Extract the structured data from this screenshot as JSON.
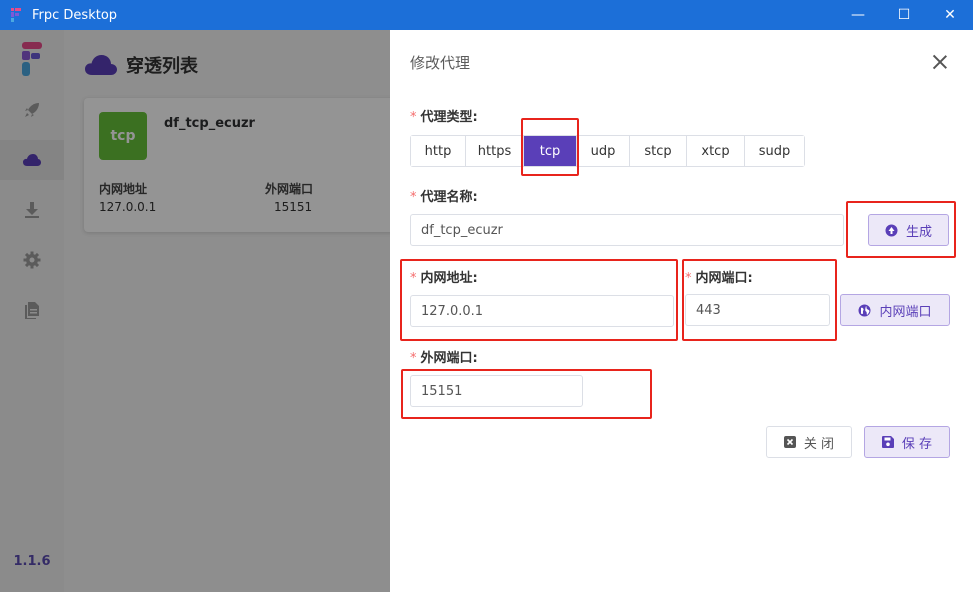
{
  "window": {
    "title": "Frpc Desktop",
    "controls": {
      "minimize": "—",
      "maximize": "☐",
      "close": "✕"
    }
  },
  "sidebar": {
    "version": "1.1.6",
    "items": [
      {
        "icon": "rocket-icon"
      },
      {
        "icon": "cloud-icon",
        "active": true
      },
      {
        "icon": "download-icon"
      },
      {
        "icon": "gear-icon"
      },
      {
        "icon": "document-icon"
      }
    ]
  },
  "page": {
    "title": "穿透列表",
    "card": {
      "badge": "tcp",
      "name": "df_tcp_ecuzr",
      "local_addr_label": "内网地址",
      "local_addr_value": "127.0.0.1",
      "remote_port_label": "外网端口",
      "remote_port_value": "15151"
    }
  },
  "drawer": {
    "title": "修改代理",
    "proxy_type": {
      "label": "代理类型:",
      "options": [
        "http",
        "https",
        "tcp",
        "udp",
        "stcp",
        "xtcp",
        "sudp"
      ],
      "selected": "tcp"
    },
    "proxy_name": {
      "label": "代理名称:",
      "value": "df_tcp_ecuzr",
      "generate_label": "生成"
    },
    "local_ip": {
      "label": "内网地址:",
      "value": "127.0.0.1"
    },
    "local_port": {
      "label": "内网端口:",
      "value": "443",
      "button_label": "内网端口"
    },
    "remote_port": {
      "label": "外网端口:",
      "value": "15151"
    },
    "footer": {
      "close_label": "关 闭",
      "save_label": "保 存"
    },
    "required_mark": "*"
  },
  "colors": {
    "titlebar": "#1c6fd8",
    "accent": "#5a3fb8",
    "badge": "#67c23a",
    "annotation": "#e8241c"
  }
}
